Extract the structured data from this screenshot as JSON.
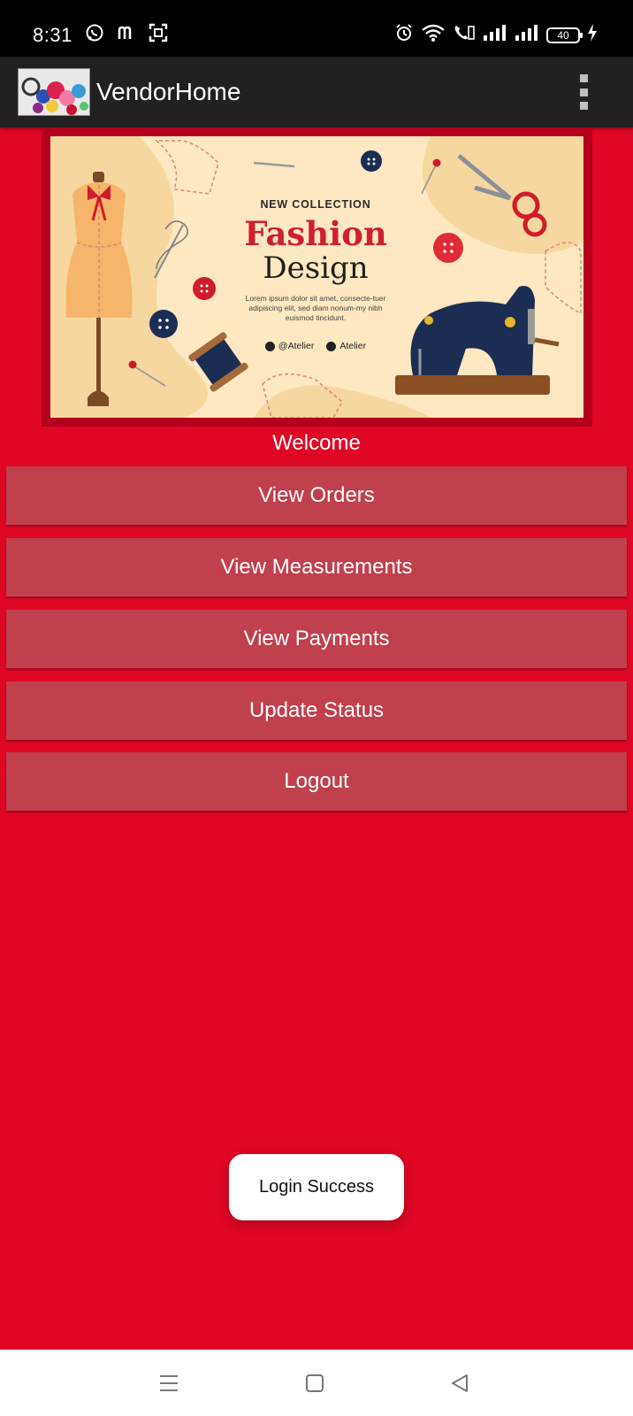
{
  "status_bar": {
    "time": "8:31",
    "battery": "40",
    "left_icons": [
      "whatsapp-icon",
      "m-app-icon",
      "scan-icon"
    ],
    "right_icons": [
      "alarm-icon",
      "wifi-icon",
      "volte-call-icon",
      "signal-icon",
      "signal-icon",
      "battery-icon",
      "charging-icon"
    ]
  },
  "app_bar": {
    "title": "VendorHome",
    "background": "#212121"
  },
  "banner": {
    "eyebrow": "NEW COLLECTION",
    "title": "Fashion",
    "subtitle": "Design",
    "body": "Lorem ipsum dolor sit amet, consecte-tuer adipiscing elit, sed diam nonum-my nibh euismod tincidunt.",
    "social_instagram": "@Atelier",
    "social_facebook": "Atelier"
  },
  "main": {
    "welcome": "Welcome",
    "background": "#e00724",
    "button_color": "#c1404e",
    "buttons": [
      {
        "label": "View Orders"
      },
      {
        "label": "View Measurements"
      },
      {
        "label": "View Payments"
      },
      {
        "label": "Update Status"
      },
      {
        "label": "Logout"
      }
    ]
  },
  "toast": {
    "message": "Login Success"
  },
  "nav_bar": {
    "icons": [
      "menu-icon",
      "home-icon",
      "back-icon"
    ]
  }
}
